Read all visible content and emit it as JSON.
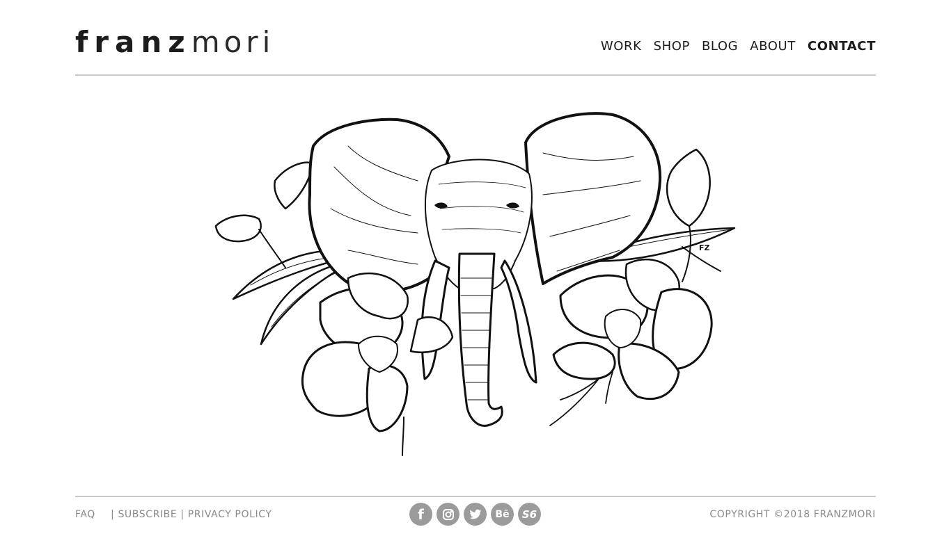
{
  "logo": {
    "bold": "franz",
    "light": "mori"
  },
  "nav": [
    {
      "label": "WORK"
    },
    {
      "label": "SHOP"
    },
    {
      "label": "BLOG"
    },
    {
      "label": "ABOUT"
    },
    {
      "label": "CONTACT",
      "active": true
    }
  ],
  "artwork": {
    "signature": "FZ"
  },
  "footer": {
    "links": [
      "FAQ",
      "SUBSCRIBE",
      "PRIVACY POLICY"
    ],
    "separator": "|",
    "social": [
      {
        "icon": "facebook-icon",
        "glyph": "f"
      },
      {
        "icon": "instagram-icon",
        "glyph": ""
      },
      {
        "icon": "twitter-icon",
        "glyph": ""
      },
      {
        "icon": "behance-icon",
        "glyph": "Bē"
      },
      {
        "icon": "society6-icon",
        "glyph": "S6"
      }
    ],
    "copyright": "COPYRIGHT ©2018 FRANZMORI"
  },
  "colors": {
    "text": "#1c1c1c",
    "muted": "#8a8a8a",
    "rule": "#c9c9c9",
    "social_bg": "#9b9b9b"
  }
}
